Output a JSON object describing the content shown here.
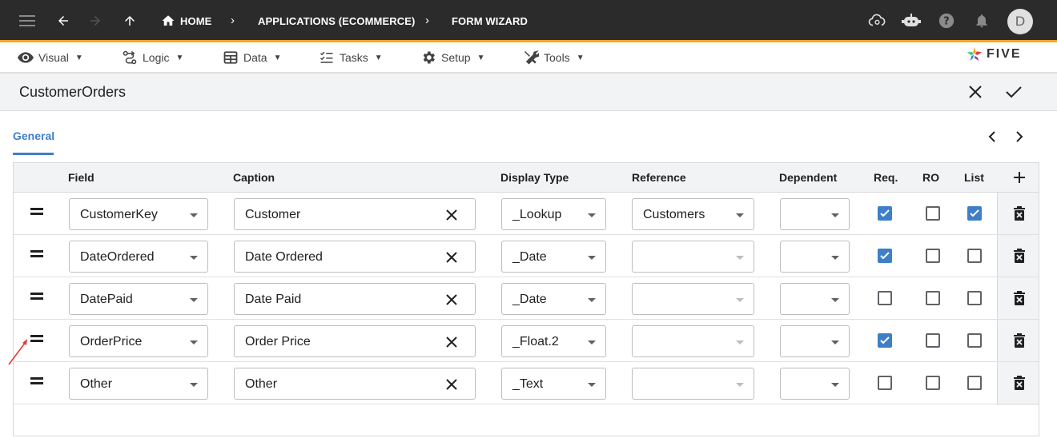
{
  "topbar": {
    "breadcrumbs": [
      "HOME",
      "APPLICATIONS (ECOMMERCE)",
      "FORM WIZARD"
    ],
    "avatar": "D"
  },
  "menu": {
    "items": [
      "Visual",
      "Logic",
      "Data",
      "Tasks",
      "Setup",
      "Tools"
    ],
    "logo": "FIVE"
  },
  "form": {
    "title": "CustomerOrders"
  },
  "tabs": {
    "general": "General"
  },
  "grid": {
    "headers": {
      "field": "Field",
      "caption": "Caption",
      "display_type": "Display Type",
      "reference": "Reference",
      "dependent": "Dependent",
      "req": "Req.",
      "ro": "RO",
      "list": "List"
    },
    "rows": [
      {
        "field": "CustomerKey",
        "caption": "Customer",
        "display_type": "_Lookup",
        "reference": "Customers",
        "dependent": "",
        "req": true,
        "ro": false,
        "list": true
      },
      {
        "field": "DateOrdered",
        "caption": "Date Ordered",
        "display_type": "_Date",
        "reference": "",
        "dependent": "",
        "req": true,
        "ro": false,
        "list": false
      },
      {
        "field": "DatePaid",
        "caption": "Date Paid",
        "display_type": "_Date",
        "reference": "",
        "dependent": "",
        "req": false,
        "ro": false,
        "list": false
      },
      {
        "field": "OrderPrice",
        "caption": "Order Price",
        "display_type": "_Float.2",
        "reference": "",
        "dependent": "",
        "req": true,
        "ro": false,
        "list": false
      },
      {
        "field": "Other",
        "caption": "Other",
        "display_type": "_Text",
        "reference": "",
        "dependent": "",
        "req": false,
        "ro": false,
        "list": false
      }
    ]
  },
  "colors": {
    "accent": "#3f7fc8",
    "topbar": "#2b2b2b",
    "topbar_border": "#f5a623",
    "annotation": "#e53935"
  }
}
